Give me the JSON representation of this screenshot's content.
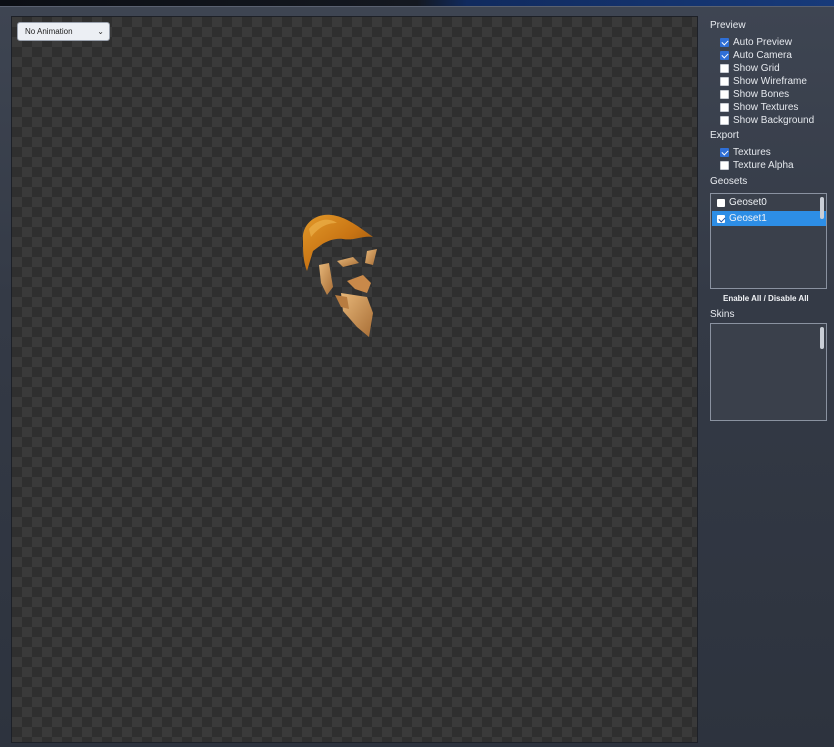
{
  "toolbar": {
    "animation_select": "No Animation"
  },
  "preview": {
    "heading": "Preview",
    "options": [
      {
        "label": "Auto Preview",
        "checked": true
      },
      {
        "label": "Auto Camera",
        "checked": true
      },
      {
        "label": "Show Grid",
        "checked": false
      },
      {
        "label": "Show Wireframe",
        "checked": false
      },
      {
        "label": "Show Bones",
        "checked": false
      },
      {
        "label": "Show Textures",
        "checked": false
      },
      {
        "label": "Show Background",
        "checked": false
      }
    ]
  },
  "export": {
    "heading": "Export",
    "options": [
      {
        "label": "Textures",
        "checked": true
      },
      {
        "label": "Texture Alpha",
        "checked": false
      }
    ]
  },
  "geosets": {
    "heading": "Geosets",
    "items": [
      {
        "label": "Geoset0",
        "checked": false,
        "selected": false
      },
      {
        "label": "Geoset1",
        "checked": true,
        "selected": true
      }
    ],
    "enable_all_label": "Enable All / Disable All"
  },
  "skins": {
    "heading": "Skins",
    "items": []
  },
  "colors": {
    "selection": "#2d8ee6",
    "checkbox_on": "#2f6fd6",
    "panel_bg": "#343a46"
  }
}
